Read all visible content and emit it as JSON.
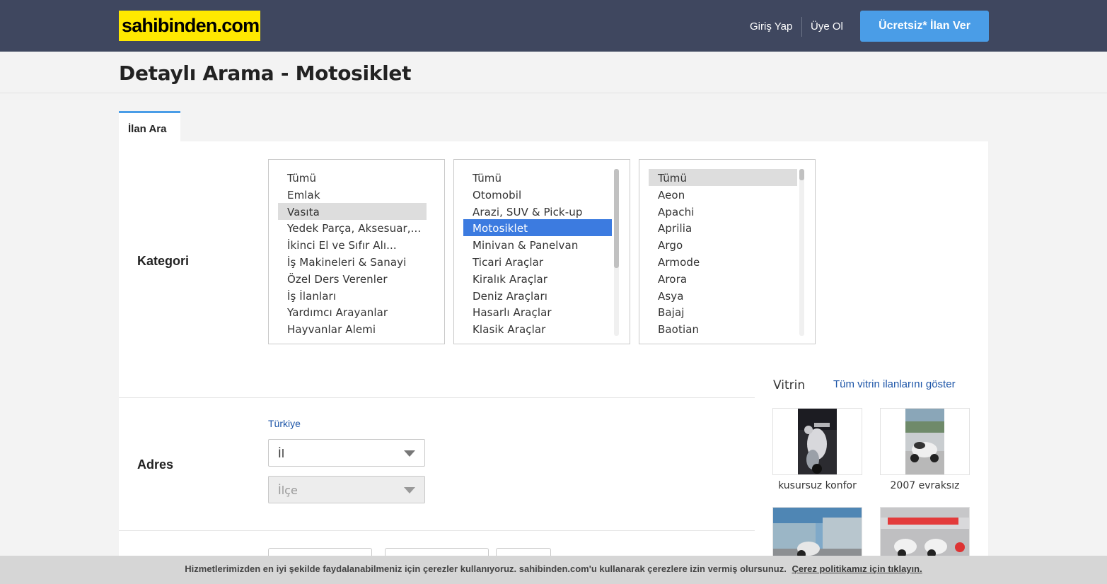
{
  "header": {
    "logo_text": "sahibinden.com",
    "login_label": "Giriş Yap",
    "register_label": "Üye Ol",
    "post_ad_label": "Ücretsiz* İlan Ver",
    "colors": {
      "topbar": "#3f475f",
      "logo_bg": "#ffe800",
      "accent": "#4a9de7"
    }
  },
  "page": {
    "title": "Detaylı Arama - Motosiklet",
    "tab_label": "İlan Ara"
  },
  "category": {
    "label": "Kategori",
    "level1": {
      "items": [
        "Tümü",
        "Emlak",
        "Vasıta",
        "Yedek Parça, Aksesuar,...",
        "İkinci El ve Sıfır Alı...",
        "İş Makineleri & Sanayi",
        "Özel Ders Verenler",
        "İş İlanları",
        "Yardımcı Arayanlar",
        "Hayvanlar Alemi"
      ],
      "selected": "Vasıta"
    },
    "level2": {
      "items": [
        "Tümü",
        "Otomobil",
        "Arazi, SUV & Pick-up",
        "Motosiklet",
        "Minivan & Panelvan",
        "Ticari Araçlar",
        "Kiralık Araçlar",
        "Deniz Araçları",
        "Hasarlı Araçlar",
        "Klasik Araçlar"
      ],
      "selected": "Motosiklet"
    },
    "level3": {
      "items": [
        "Tümü",
        "Aeon",
        "Apachi",
        "Aprilia",
        "Argo",
        "Armode",
        "Arora",
        "Asya",
        "Bajaj",
        "Baotian"
      ],
      "selected": "Tümü"
    }
  },
  "address": {
    "label": "Adres",
    "country": "Türkiye",
    "city_value": "İl",
    "district_value": "İlçe"
  },
  "showcase": {
    "title": "Vitrin",
    "show_all_label": "Tüm vitrin ilanlarını göster",
    "items": [
      {
        "caption": "kusursuz konfor"
      },
      {
        "caption": "2007 evraksız"
      },
      {
        "caption": ""
      },
      {
        "caption": ""
      }
    ]
  },
  "cookie": {
    "text": "Hizmetlerimizden en iyi şekilde faydalanabilmeniz için çerezler kullanıyoruz. sahibinden.com'u kullanarak çerezlere izin vermiş olursunuz.",
    "link_label": "Çerez politikamız için tıklayın."
  }
}
